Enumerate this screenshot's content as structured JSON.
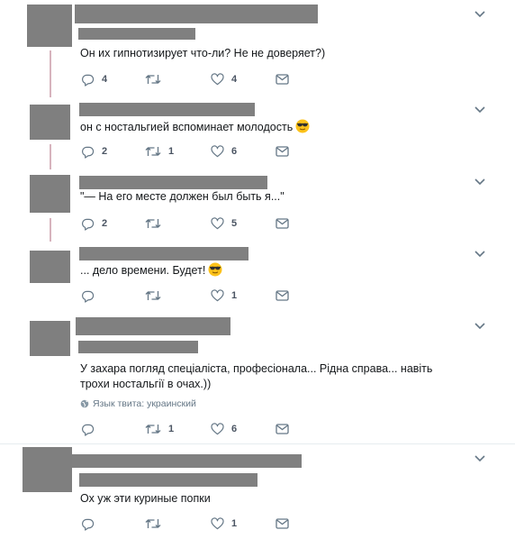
{
  "colors": {
    "redaction": "#808080",
    "thread_line": "#d7b3bd",
    "icon": "#657786",
    "emoji_face": "#fcc21b"
  },
  "tweets": [
    {
      "text": "Он их гипнотизирует что-ли? Не не доверяет?)",
      "reply_count": "4",
      "retweet_count": "",
      "like_count": "4",
      "emoji": ""
    },
    {
      "text": "он с ностальгией вспоминает молодость",
      "reply_count": "2",
      "retweet_count": "1",
      "like_count": "6",
      "emoji": "sunglasses-emoji"
    },
    {
      "text": "\"— На его месте должен был быть я...\"",
      "reply_count": "2",
      "retweet_count": "",
      "like_count": "5",
      "emoji": ""
    },
    {
      "text": "... дело времени. Будет!",
      "reply_count": "",
      "retweet_count": "",
      "like_count": "1",
      "emoji": "sunglasses-emoji"
    },
    {
      "text": "У захара погляд спеціаліста, професіонала... Рідна справа... навіть трохи ностальгії в очах.))",
      "language_note": "Язык твита: украинский",
      "reply_count": "",
      "retweet_count": "1",
      "like_count": "6",
      "emoji": ""
    },
    {
      "text": "Ох уж эти куриные попки",
      "reply_count": "",
      "retweet_count": "",
      "like_count": "1",
      "emoji": ""
    }
  ],
  "icons": {
    "reply": "reply-icon",
    "retweet": "retweet-icon",
    "like": "heart-icon",
    "dm": "envelope-icon",
    "menu": "chevron-down-icon",
    "globe": "globe-icon"
  }
}
